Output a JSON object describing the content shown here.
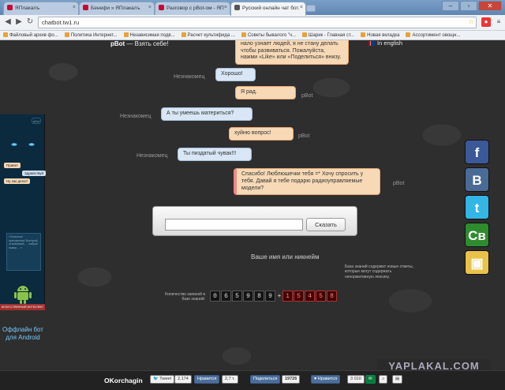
{
  "tabs": [
    {
      "label": "ЯПлакалъ",
      "active": false
    },
    {
      "label": "Бенефи » ЯПлакалъ",
      "active": false
    },
    {
      "label": "Разговор с pBot-ом - ЯП",
      "active": false
    },
    {
      "label": "Русский онлайн чат бот.",
      "active": true
    }
  ],
  "url": "chatbot.tw1.ru",
  "bookmarks": [
    "Файловый архив фо...",
    "Политика Интернет...",
    "Независимая подв...",
    "Расчет культифида ...",
    "Советы бывалого \"ч...",
    "Шарик - Главная ст...",
    "Новая вкладка",
    "Ассортимент овощн..."
  ],
  "site": {
    "logo_bold": "pBot",
    "logo_text": " — Взять себе!",
    "lang": "In english"
  },
  "chat": {
    "top_bot": "получаю за него денег. Если оно мне нало узнает людей, я не стану делать чтобы развиваться. Пожалуйста, нажми «Like» или «Поделиться» внизу.",
    "m1_who": "Незнакомец",
    "m1": "Хорошо!",
    "m2": "Я рад.",
    "m2_who": "pBot",
    "m3_who": "Незнакомец",
    "m3": "А ты умеешь материться?",
    "m4": "хуйню вопрос!",
    "m4_who": "pBot",
    "m5_who": "Незнакомец",
    "m5": "Ты пиздатый чувак!!!",
    "m6": "Спасибо! Люблюшечки тебя =* Хочу спросить у тебя. Давай я тебе подарю радиоуправляемые модели?",
    "m6_who": "pBot"
  },
  "android": {
    "badge": "pBot",
    "b1": "Привет",
    "b2": "Здравствуй",
    "b3": "Ну как дела?",
    "note": "«Отличное приложение! Быстрый, отзывчивый, ... набрал номер ... »",
    "cta": "Оффлайн бот для Android",
    "footer": "ИСКУССТВЕННЫЙ ИНТЕЛЛЕКТ"
  },
  "share_icons": [
    "facebook-icon",
    "vkontakte-icon",
    "twitter-icon",
    "classmates-icon",
    "moimir-icon"
  ],
  "input": {
    "placeholder": "",
    "send_label": "Сказать",
    "nickname_label": "Ваше имя или никнейм"
  },
  "kb_note": "База знаний содержит новые ответы, которые могут содержать ненормативную лексику.",
  "counter": {
    "label": "Количество записей в базе знаний:",
    "left_digits": [
      "0",
      "6",
      "5",
      "9",
      "8",
      "9"
    ],
    "right_digits": [
      "1",
      "5",
      "4",
      "5",
      "8"
    ]
  },
  "footer": {
    "name": "OKorchagin",
    "tweet": "Tweet",
    "tweet_count": "2,174",
    "like": "Нравится",
    "like_count": "2,7 т.",
    "vk_share": "Поделиться",
    "vk_count": "19726",
    "vk_like": "Нравится",
    "vk_like_count": "3 010"
  },
  "watermark": "YAPLAKAL.COM"
}
